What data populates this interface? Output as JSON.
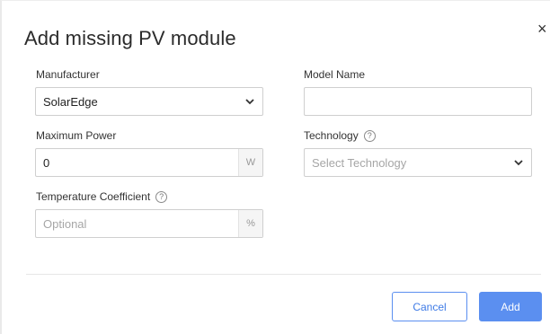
{
  "dialog": {
    "title": "Add missing PV module",
    "close_glyph": "×"
  },
  "form": {
    "manufacturer": {
      "label": "Manufacturer",
      "value": "SolarEdge"
    },
    "model_name": {
      "label": "Model Name",
      "value": ""
    },
    "maximum_power": {
      "label": "Maximum Power",
      "value": "0",
      "unit": "W"
    },
    "technology": {
      "label": "Technology",
      "placeholder": "Select Technology",
      "help_glyph": "?"
    },
    "temperature_coefficient": {
      "label": "Temperature Coefficient",
      "placeholder": "Optional",
      "unit": "%",
      "help_glyph": "?"
    }
  },
  "actions": {
    "cancel_label": "Cancel",
    "add_label": "Add"
  },
  "colors": {
    "accent": "#5b8ff0",
    "border": "#cfcfcf",
    "placeholder": "#a6a6a6"
  },
  "icons": {
    "close": "close-icon",
    "dropdown": "chevron-down-icon",
    "help": "help-icon"
  }
}
